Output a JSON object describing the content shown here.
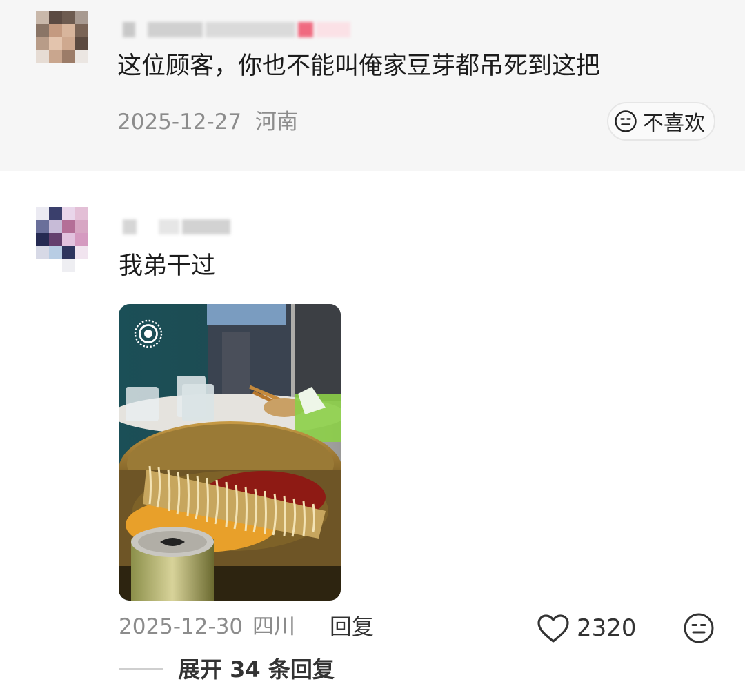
{
  "comment_one": {
    "text": "这位顾客，你也不能叫俺家豆芽都吊死到这把",
    "date": "2025-12-27",
    "location": "河南",
    "dislike_label": "不喜欢",
    "icon": "neutral-face-icon"
  },
  "comment_two": {
    "text": "我弟干过",
    "date": "2025-12-30",
    "location": "四川",
    "reply_label": "回复",
    "like_count": "2320",
    "photo_icon": "live-photo-icon",
    "like_icon": "heart-outline-icon",
    "dislike_icon": "neutral-face-icon"
  },
  "expand": {
    "label": "展开 34 条回复"
  },
  "colors": {
    "text_primary": "#1c1c1c",
    "text_meta": "#8c8c8c",
    "block_bg": "#f6f6f6"
  }
}
